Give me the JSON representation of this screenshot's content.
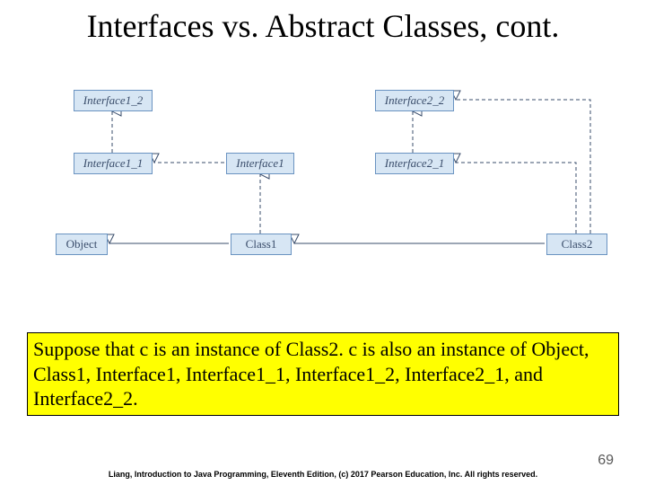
{
  "title": "Interfaces vs. Abstract Classes, cont.",
  "diagram": {
    "interface1_2": "Interface1_2",
    "interface2_2": "Interface2_2",
    "interface1_1": "Interface1_1",
    "interface1": "Interface1",
    "interface2_1": "Interface2_1",
    "object": "Object",
    "class1": "Class1",
    "class2": "Class2"
  },
  "body_text": "Suppose that c is an instance of Class2. c is also an instance of Object, Class1, Interface1, Interface1_1, Interface1_2, Interface2_1, and Interface2_2.",
  "footer": "Liang, Introduction to Java Programming, Eleventh Edition, (c) 2017 Pearson Education, Inc. All rights reserved.",
  "page_number": "69"
}
